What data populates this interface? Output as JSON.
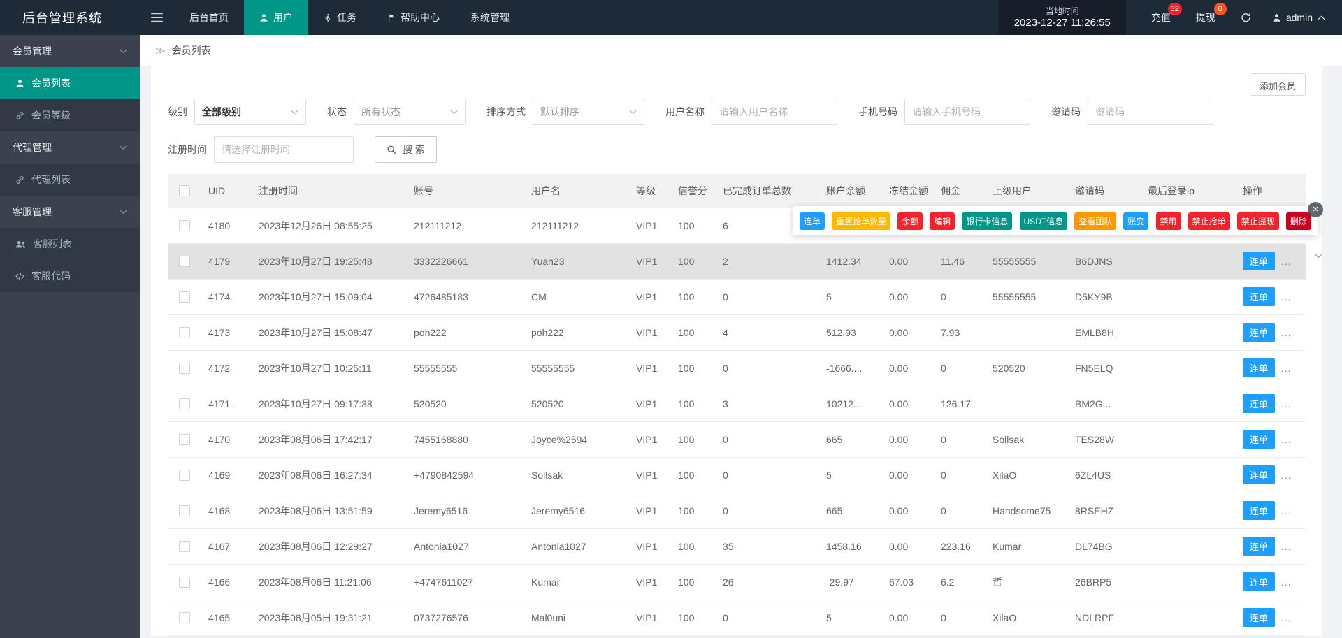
{
  "topbar": {
    "title": "后台管理系统",
    "nav_items": [
      {
        "label": "后台首页",
        "icon": "",
        "active": false
      },
      {
        "label": "用户",
        "icon": "person",
        "active": true
      },
      {
        "label": "任务",
        "icon": "walk",
        "active": false
      },
      {
        "label": "帮助中心",
        "icon": "flag",
        "active": false
      },
      {
        "label": "系统管理",
        "icon": "",
        "active": false
      }
    ],
    "local_time_label": "当地时间",
    "local_time_value": "2023-12-27 11:26:55",
    "recharge": {
      "label": "充值",
      "badge": "32"
    },
    "withdraw": {
      "label": "提现",
      "badge": "0"
    },
    "admin_name": "admin"
  },
  "sidebar": {
    "items": [
      {
        "label": "会员管理",
        "kind": "group",
        "icon": "",
        "chevron": true,
        "active": false
      },
      {
        "label": "会员列表",
        "kind": "child",
        "icon": "person",
        "chevron": false,
        "active": true
      },
      {
        "label": "会员等级",
        "kind": "child",
        "icon": "link",
        "chevron": false,
        "active": false
      },
      {
        "label": "代理管理",
        "kind": "group",
        "icon": "",
        "chevron": true,
        "active": false
      },
      {
        "label": "代理列表",
        "kind": "child",
        "icon": "link",
        "chevron": false,
        "active": false
      },
      {
        "label": "客服管理",
        "kind": "group",
        "icon": "",
        "chevron": true,
        "active": false
      },
      {
        "label": "客服列表",
        "kind": "child",
        "icon": "people",
        "chevron": false,
        "active": false
      },
      {
        "label": "客服代码",
        "kind": "child",
        "icon": "code",
        "chevron": false,
        "active": false
      }
    ]
  },
  "page": {
    "breadcrumb_arrow": "≫",
    "breadcrumb": "会员列表",
    "add_button": "添加会员"
  },
  "filters": {
    "level": {
      "label": "级别",
      "value": "全部级别"
    },
    "status": {
      "label": "状态",
      "value": "所有状态"
    },
    "sort": {
      "label": "排序方式",
      "value": "默认排序"
    },
    "username": {
      "label": "用户名称",
      "placeholder": "请输入用户名称"
    },
    "phone": {
      "label": "手机号码",
      "placeholder": "请输入手机号码"
    },
    "invite": {
      "label": "邀请码",
      "placeholder": "邀请码"
    },
    "regtime": {
      "label": "注册时间",
      "placeholder": "请选择注册时间"
    },
    "search_label": "搜 索"
  },
  "table": {
    "headers": [
      "UID",
      "注册时间",
      "账号",
      "用户名",
      "等级",
      "信誉分",
      "已完成订单总数",
      "账户余额",
      "冻结金额",
      "佣金",
      "上级用户",
      "邀请码",
      "最后登录ip",
      "操作"
    ],
    "row_action_label": "连单",
    "row_more_label": "...",
    "rows": [
      {
        "uid": "4180",
        "reg_time": "2023年12月26日 08:55:25",
        "account": "212111212",
        "username": "212111212",
        "level": "VIP1",
        "credit": "100",
        "orders": "6",
        "balance": "",
        "frozen": "",
        "commission": "",
        "parent": "",
        "invite": "",
        "ip": "",
        "actions_open": true,
        "highlight": false
      },
      {
        "uid": "4179",
        "reg_time": "2023年10月27日 19:25:48",
        "account": "3332226661",
        "username": "Yuan23",
        "level": "VIP1",
        "credit": "100",
        "orders": "2",
        "balance": "1412.34",
        "frozen": "0.00",
        "commission": "11.46",
        "parent": "55555555",
        "invite": "B6DJNS",
        "ip": "",
        "actions_open": false,
        "highlight": true
      },
      {
        "uid": "4174",
        "reg_time": "2023年10月27日 15:09:04",
        "account": "4726485183",
        "username": "CM",
        "level": "VIP1",
        "credit": "100",
        "orders": "0",
        "balance": "5",
        "frozen": "0.00",
        "commission": "0",
        "parent": "55555555",
        "invite": "D5KY9B",
        "ip": "",
        "actions_open": false,
        "highlight": false
      },
      {
        "uid": "4173",
        "reg_time": "2023年10月27日 15:08:47",
        "account": "poh222",
        "username": "poh222",
        "level": "VIP1",
        "credit": "100",
        "orders": "4",
        "balance": "512.93",
        "frozen": "0.00",
        "commission": "7.93",
        "parent": "",
        "invite": "EMLB8H",
        "ip": "",
        "actions_open": false,
        "highlight": false
      },
      {
        "uid": "4172",
        "reg_time": "2023年10月27日 10:25:11",
        "account": "55555555",
        "username": "55555555",
        "level": "VIP1",
        "credit": "100",
        "orders": "0",
        "balance": "-1666....",
        "frozen": "0.00",
        "commission": "0",
        "parent": "520520",
        "invite": "FN5ELQ",
        "ip": "",
        "actions_open": false,
        "highlight": false
      },
      {
        "uid": "4171",
        "reg_time": "2023年10月27日 09:17:38",
        "account": "520520",
        "username": "520520",
        "level": "VIP1",
        "credit": "100",
        "orders": "3",
        "balance": "10212....",
        "frozen": "0.00",
        "commission": "126.17",
        "parent": "",
        "invite": "BM2G...",
        "ip": "",
        "actions_open": false,
        "highlight": false
      },
      {
        "uid": "4170",
        "reg_time": "2023年08月06日 17:42:17",
        "account": "7455168880",
        "username": "Joyce%2594",
        "level": "VIP1",
        "credit": "100",
        "orders": "0",
        "balance": "665",
        "frozen": "0.00",
        "commission": "0",
        "parent": "Sollsak",
        "invite": "TES28W",
        "ip": "",
        "actions_open": false,
        "highlight": false
      },
      {
        "uid": "4169",
        "reg_time": "2023年08月06日 16:27:34",
        "account": "+4790842594",
        "username": "Sollsak",
        "level": "VIP1",
        "credit": "100",
        "orders": "0",
        "balance": "5",
        "frozen": "0.00",
        "commission": "0",
        "parent": "XilaO",
        "invite": "6ZL4US",
        "ip": "",
        "actions_open": false,
        "highlight": false
      },
      {
        "uid": "4168",
        "reg_time": "2023年08月06日 13:51:59",
        "account": "Jeremy6516",
        "username": "Jeremy6516",
        "level": "VIP1",
        "credit": "100",
        "orders": "0",
        "balance": "665",
        "frozen": "0.00",
        "commission": "0",
        "parent": "Handsome75",
        "invite": "8RSEHZ",
        "ip": "",
        "actions_open": false,
        "highlight": false
      },
      {
        "uid": "4167",
        "reg_time": "2023年08月06日 12:29:27",
        "account": "Antonia1027",
        "username": "Antonia1027",
        "level": "VIP1",
        "credit": "100",
        "orders": "35",
        "balance": "1458.16",
        "frozen": "0.00",
        "commission": "223.16",
        "parent": "Kumar",
        "invite": "DL74BG",
        "ip": "",
        "actions_open": false,
        "highlight": false
      },
      {
        "uid": "4166",
        "reg_time": "2023年08月06日 11:21:06",
        "account": "+4747611027",
        "username": "Kumar",
        "level": "VIP1",
        "credit": "100",
        "orders": "26",
        "balance": "-29.97",
        "frozen": "67.03",
        "commission": "6.2",
        "parent": "哲",
        "invite": "26BRP5",
        "ip": "",
        "actions_open": false,
        "highlight": false
      },
      {
        "uid": "4165",
        "reg_time": "2023年08月05日 19:31:21",
        "account": "0737276576",
        "username": "Mal0uni",
        "level": "VIP1",
        "credit": "100",
        "orders": "0",
        "balance": "5",
        "frozen": "0.00",
        "commission": "0",
        "parent": "XilaO",
        "invite": "NDLRPF",
        "ip": "",
        "actions_open": false,
        "highlight": false
      }
    ]
  },
  "action_popup": {
    "buttons": [
      {
        "label": "连单",
        "color": "#1e9fff"
      },
      {
        "label": "重置抢单数量",
        "color": "#ffb800"
      },
      {
        "label": "余额",
        "color": "#f5222d"
      },
      {
        "label": "编辑",
        "color": "#f5222d"
      },
      {
        "label": "银行卡信息",
        "color": "#009688"
      },
      {
        "label": "USDT信息",
        "color": "#009688"
      },
      {
        "label": "查看团队",
        "color": "#ff9800"
      },
      {
        "label": "账变",
        "color": "#1e9fff"
      },
      {
        "label": "禁用",
        "color": "#f5222d"
      },
      {
        "label": "禁止抢单",
        "color": "#f5222d"
      },
      {
        "label": "禁止提现",
        "color": "#f5222d"
      },
      {
        "label": "删除",
        "color": "#c9001f"
      }
    ]
  },
  "colors": {
    "topbar_bg": "#1e2a38",
    "sidebar_bg": "#39424e",
    "accent_teal": "#009688",
    "primary_blue": "#1e9fff",
    "badge_red": "#f5222d",
    "badge_orange": "#ff5722"
  }
}
